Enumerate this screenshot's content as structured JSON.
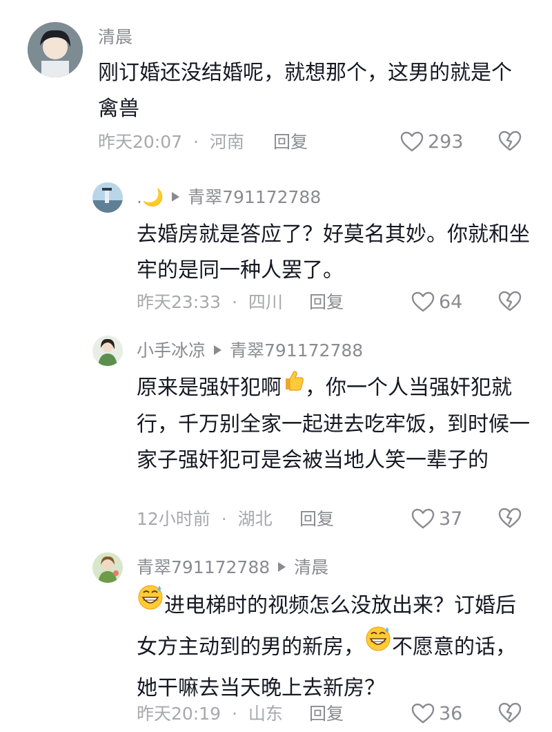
{
  "comments": [
    {
      "user": "清晨",
      "text": "刚订婚还没结婚呢，就想那个，这男的就是个禽兽",
      "time": "昨天20:07",
      "location": "河南",
      "reply_label": "回复",
      "likes": "293"
    },
    {
      "user": ".🌙",
      "reply_to": "青翠791172788",
      "text": "去婚房就是答应了？好莫名其妙。你就和坐牢的是同一种人罢了。",
      "time": "昨天23:33",
      "location": "四川",
      "reply_label": "回复",
      "likes": "64"
    },
    {
      "user": "小手冰凉",
      "reply_to": "青翠791172788",
      "text_parts": [
        "原来是强奸犯啊",
        "，你一个人当强奸犯就行，千万别全家一起进去吃牢饭，到时候一家子强奸犯可是会被当地人笑一辈子的"
      ],
      "emoji": "thumbs-up",
      "time": "12小时前",
      "location": "湖北",
      "reply_label": "回复",
      "likes": "37"
    },
    {
      "user": "青翠791172788",
      "reply_to": "清晨",
      "text_parts": [
        "进电梯时的视频怎么没放出来？订婚后女方主动到的男的新房，",
        "不愿意的话，她干嘛去当天晚上去新房？"
      ],
      "emoji": "grinning-sweat",
      "time": "昨天20:19",
      "location": "山东",
      "reply_label": "回复",
      "likes": "36"
    }
  ],
  "separator": "·",
  "colors": {
    "text": "#161823",
    "meta": "#a7a8ad",
    "secondary": "#8a8b91"
  }
}
